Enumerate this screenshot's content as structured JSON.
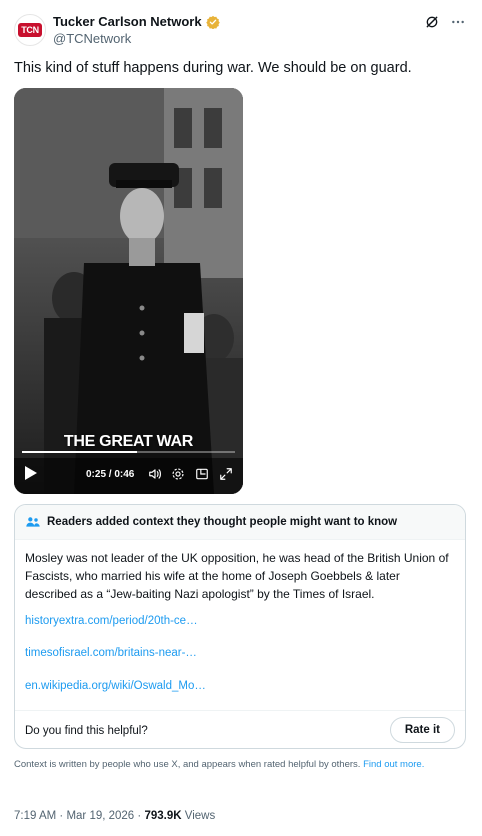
{
  "author": {
    "display_name": "Tucker Carlson Network",
    "handle": "@TCNetwork",
    "avatar_text": "TCN",
    "verified_color": "#e8b339"
  },
  "tweet": {
    "text": "This kind of stuff happens during war. We should be on guard."
  },
  "video": {
    "caption": "THE GREAT WAR",
    "timecode": "0:25 / 0:46",
    "progress_fraction": 0.54
  },
  "community_note": {
    "header": "Readers added context they thought people might want to know",
    "body": "Mosley was not leader of the UK opposition, he was head of the British Union of Fascists, who married his wife at the home of Joseph Goebbels & later described as a “Jew-baiting Nazi apologist” by the Times of Israel.",
    "links": [
      "historyextra.com/period/20th-ce…",
      "timesofisrael.com/britains-near-…",
      "en.wikipedia.org/wiki/Oswald_Mo…"
    ],
    "helpful_question": "Do you find this helpful?",
    "rate_button": "Rate it"
  },
  "context_footer": {
    "text": "Context is written by people who use X, and appears when rated helpful by others.",
    "link": "Find out more."
  },
  "meta": {
    "time": "7:19 AM",
    "separator": " · ",
    "date": "Mar 19, 2026",
    "views_count": "793.9K",
    "views_label": "Views"
  },
  "colors": {
    "link": "#1d9bf0",
    "muted": "#536471",
    "brand_red": "#c8102e"
  }
}
